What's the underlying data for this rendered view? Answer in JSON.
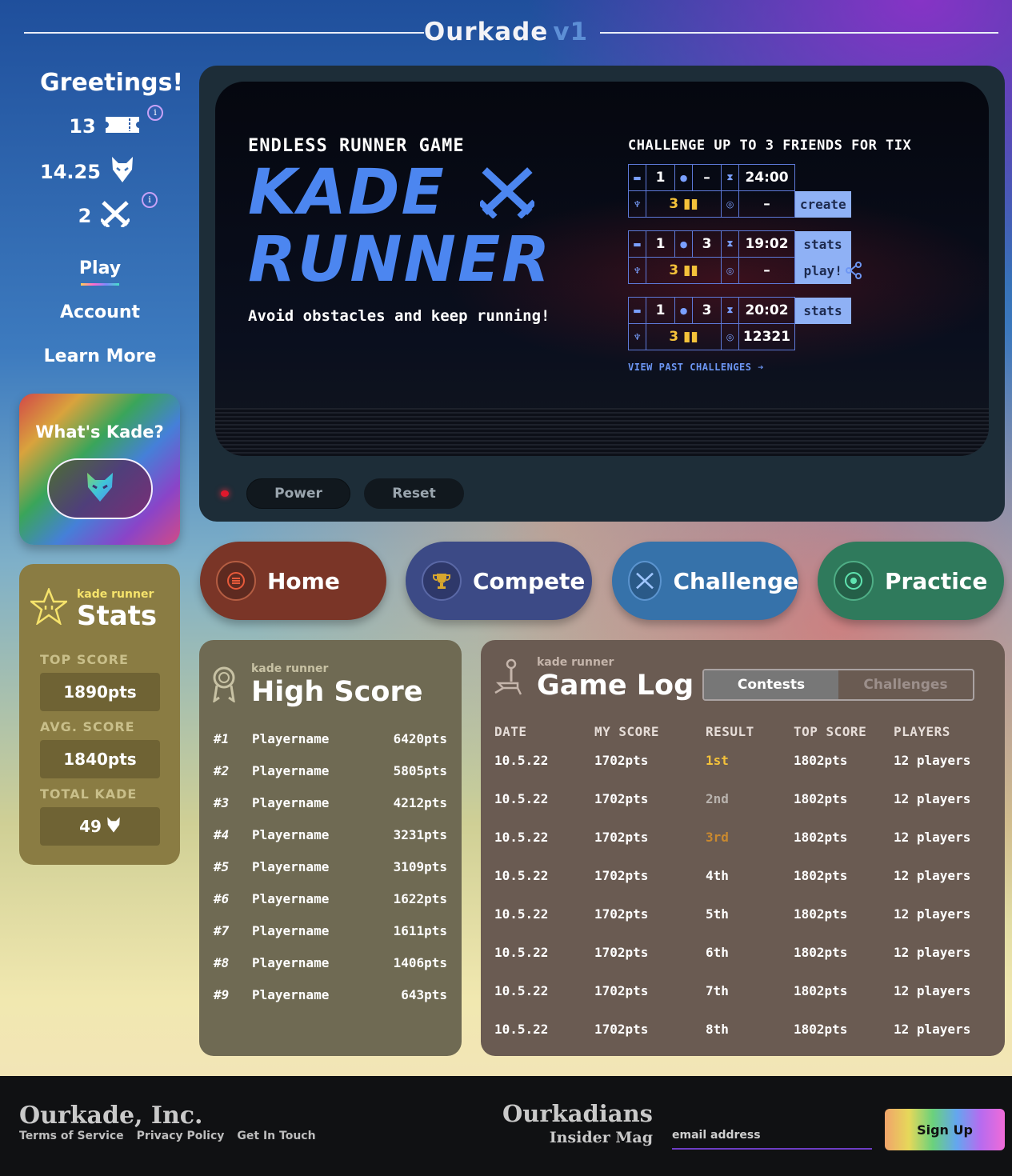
{
  "header": {
    "brand": "Ourkade",
    "version": "v1"
  },
  "sidebar": {
    "greeting": "Greetings!",
    "tickets": "13",
    "kade": "14.25",
    "battles": "2",
    "nav": [
      "Play",
      "Account",
      "Learn More"
    ],
    "whats_kade": "What's Kade?"
  },
  "stats": {
    "subtitle": "kade runner",
    "title": "Stats",
    "top_score_label": "TOP SCORE",
    "top_score": "1890pts",
    "avg_score_label": "AVG. SCORE",
    "avg_score": "1840pts",
    "total_kade_label": "TOTAL KADE",
    "total_kade": "49"
  },
  "game": {
    "eyebrow": "ENDLESS RUNNER GAME",
    "title_line1": "KADE",
    "title_line2": "RUNNER",
    "description": "Avoid obstacles and keep running!",
    "challenge_heading": "CHALLENGE UP TO 3 FRIENDS FOR TIX",
    "challenges": [
      {
        "tix": "1",
        "players": "–",
        "time": "24:00",
        "entry": "3",
        "score": "–",
        "btn_top": "",
        "btn_bottom": "create"
      },
      {
        "tix": "1",
        "players": "3",
        "time": "19:02",
        "entry": "3",
        "score": "–",
        "btn_top": "stats",
        "btn_bottom": "play!"
      },
      {
        "tix": "1",
        "players": "3",
        "time": "20:02",
        "entry": "3",
        "score": "12321",
        "btn_top": "stats",
        "btn_bottom": ""
      }
    ],
    "view_past": "VIEW PAST CHALLENGES ➔"
  },
  "controls": {
    "power": "Power",
    "reset": "Reset"
  },
  "modes": [
    {
      "label": "Home",
      "color": "#7a3527",
      "icon_color": "#e85a3a"
    },
    {
      "label": "Compete",
      "color": "#3c4a86",
      "icon_color": "#d7a62e"
    },
    {
      "label": "Challenge",
      "color": "#3672aa",
      "icon_color": "#6fa8f0"
    },
    {
      "label": "Practice",
      "color": "#2f7a5c",
      "icon_color": "#5fe3b0"
    }
  ],
  "high_score": {
    "subtitle": "kade runner",
    "title": "High Score",
    "rows": [
      {
        "rank": "#1",
        "name": "Playername",
        "points": "6420pts"
      },
      {
        "rank": "#2",
        "name": "Playername",
        "points": "5805pts"
      },
      {
        "rank": "#3",
        "name": "Playername",
        "points": "4212pts"
      },
      {
        "rank": "#4",
        "name": "Playername",
        "points": "3231pts"
      },
      {
        "rank": "#5",
        "name": "Playername",
        "points": "3109pts"
      },
      {
        "rank": "#6",
        "name": "Playername",
        "points": "1622pts"
      },
      {
        "rank": "#7",
        "name": "Playername",
        "points": "1611pts"
      },
      {
        "rank": "#8",
        "name": "Playername",
        "points": "1406pts"
      },
      {
        "rank": "#9",
        "name": "Playername",
        "points": "643pts"
      }
    ]
  },
  "game_log": {
    "subtitle": "kade runner",
    "title": "Game Log",
    "tabs": [
      "Contests",
      "Challenges"
    ],
    "active_tab": "Contests",
    "columns": [
      "DATE",
      "MY SCORE",
      "RESULT",
      "TOP SCORE",
      "PLAYERS"
    ],
    "rows": [
      {
        "date": "10.5.22",
        "my_score": "1702pts",
        "result": "1st",
        "result_color": "#f4c23a",
        "top_score": "1802pts",
        "players": "12 players"
      },
      {
        "date": "10.5.22",
        "my_score": "1702pts",
        "result": "2nd",
        "result_color": "#b9b3ae",
        "top_score": "1802pts",
        "players": "12 players"
      },
      {
        "date": "10.5.22",
        "my_score": "1702pts",
        "result": "3rd",
        "result_color": "#c9892f",
        "top_score": "1802pts",
        "players": "12 players"
      },
      {
        "date": "10.5.22",
        "my_score": "1702pts",
        "result": "4th",
        "result_color": "#ffffff",
        "top_score": "1802pts",
        "players": "12 players"
      },
      {
        "date": "10.5.22",
        "my_score": "1702pts",
        "result": "5th",
        "result_color": "#ffffff",
        "top_score": "1802pts",
        "players": "12 players"
      },
      {
        "date": "10.5.22",
        "my_score": "1702pts",
        "result": "6th",
        "result_color": "#ffffff",
        "top_score": "1802pts",
        "players": "12 players"
      },
      {
        "date": "10.5.22",
        "my_score": "1702pts",
        "result": "7th",
        "result_color": "#ffffff",
        "top_score": "1802pts",
        "players": "12 players"
      },
      {
        "date": "10.5.22",
        "my_score": "1702pts",
        "result": "8th",
        "result_color": "#ffffff",
        "top_score": "1802pts",
        "players": "12 players"
      }
    ]
  },
  "footer": {
    "company": "Ourkade, Inc.",
    "links": [
      "Terms of Service",
      "Privacy Policy",
      "Get In Touch"
    ],
    "mag_title": "Ourkadians",
    "mag_subtitle": "Insider Mag",
    "email_placeholder": "email address",
    "signup": "Sign Up"
  }
}
